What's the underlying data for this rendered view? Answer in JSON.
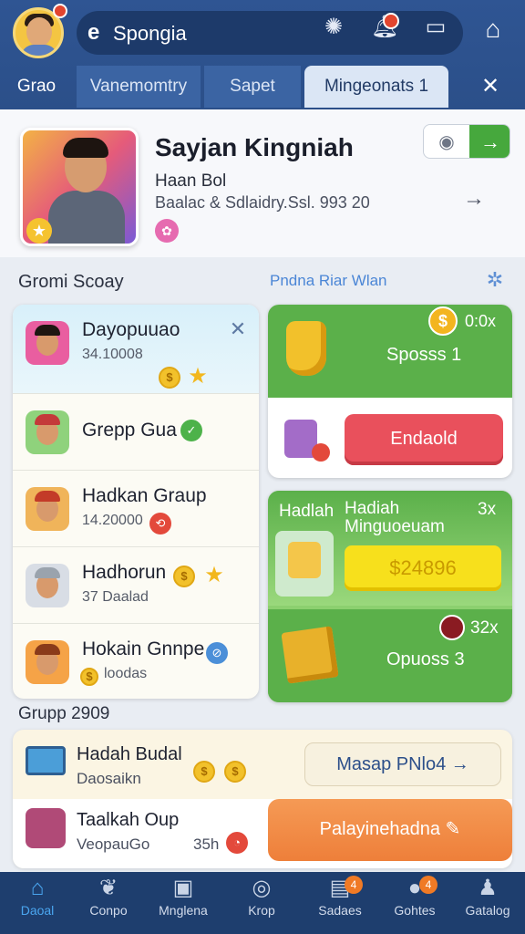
{
  "header": {
    "app_title": "Spongia",
    "search_icon": "e",
    "icons": [
      "bug-icon",
      "bell-icon",
      "message-icon",
      "home-icon"
    ]
  },
  "tabs": [
    "Grao",
    "Vanemomtry",
    "Sapet",
    "Mingeonats 1"
  ],
  "profile": {
    "name": "Sayjan Kingniah",
    "subtitle": "Haan Bol",
    "details": "Baalac & Sdlaidry.Ssl. 993  20"
  },
  "section": {
    "title": "Gromi Scoay",
    "link": "Pndna Riar Wlan"
  },
  "left_list": [
    {
      "name": "Dayopuuao",
      "sub": "34.10008"
    },
    {
      "name": "Grepp Gua",
      "sub": ""
    },
    {
      "name": "Hadkan Graup",
      "sub": "14.20000"
    },
    {
      "name": "Hadhorun",
      "sub": "37 Daalad"
    },
    {
      "name": "Hokain Gnnpe",
      "sub": "loodas"
    }
  ],
  "right_cards": {
    "card1": {
      "label": "Sposss 1",
      "multiplier": "0:0x",
      "button": "Endaold"
    },
    "card2": {
      "title_a": "Hadlah",
      "title_b": "Hadiah Minguoeuam",
      "multiplier": "3x",
      "price": "$24896"
    },
    "card3": {
      "multiplier": "32x",
      "label": "Opuoss 3"
    }
  },
  "group": {
    "title": "Grupp 2909",
    "row1": {
      "name": "Hadah Budal",
      "sub": "Daosaikn",
      "button": "Masap PNlo4"
    },
    "row2": {
      "name": "Taalkah Oup",
      "sub": "VeopauGo",
      "count": "35h",
      "button": "Palayinehadna"
    }
  },
  "nav": [
    {
      "label": "Daoal",
      "icon": "home-icon"
    },
    {
      "label": "Conpo",
      "icon": "people-icon"
    },
    {
      "label": "Mnglena",
      "icon": "monitor-icon"
    },
    {
      "label": "Krop",
      "icon": "search-icon"
    },
    {
      "label": "Sadaes",
      "icon": "document-icon",
      "badge": "4"
    },
    {
      "label": "Gohtes",
      "icon": "chat-icon",
      "badge": "4"
    },
    {
      "label": "Gatalog",
      "icon": "user-icon"
    }
  ],
  "colors": {
    "header": "#2b4f89",
    "accent_green": "#5bb04a",
    "button_red": "#e9505c",
    "button_orange": "#ee7f3a",
    "price_yellow": "#f7e01c"
  }
}
